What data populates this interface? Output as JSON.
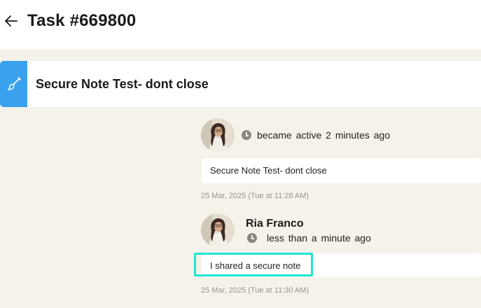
{
  "header": {
    "title": "Task #669800",
    "back_icon": "arrow-left-icon"
  },
  "task": {
    "title": "Secure Note Test- dont close",
    "icon": "brush-icon",
    "icon_color": "#3aa1ee"
  },
  "feed": [
    {
      "avatar": "avatar",
      "author": "",
      "status": "became active 2 minutes ago",
      "message": "Secure Note Test- dont close",
      "timestamp": "25 Mar, 2025 (Tue at 11:28 AM)"
    },
    {
      "avatar": "avatar",
      "author": "Ria Franco",
      "status": "less than a minute ago",
      "message": "I shared a secure note",
      "timestamp": "25 Mar, 2025 (Tue at 11:30 AM)"
    }
  ],
  "colors": {
    "background": "#f5f2ea",
    "highlight": "#20e6d3"
  }
}
